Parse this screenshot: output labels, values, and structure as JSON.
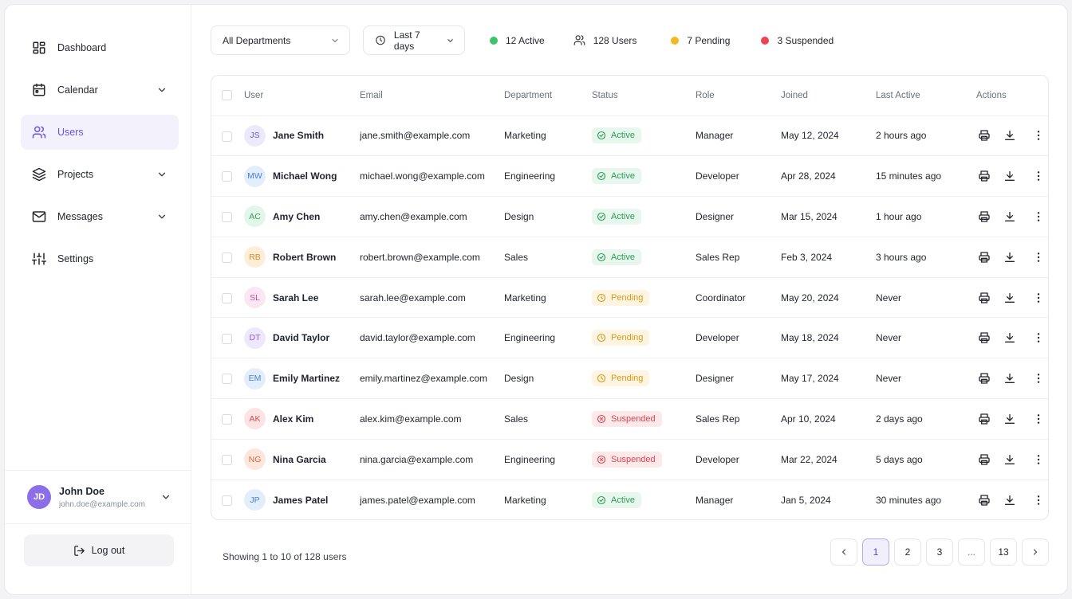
{
  "colors": {
    "accent": "#6d4ee8",
    "active": "#2c9a56",
    "pending": "#d99a12",
    "suspended": "#df4450",
    "dot_active": "#3cc36b",
    "dot_pending": "#f5b81f",
    "dot_suspended": "#ee4452"
  },
  "sidebar": {
    "items": [
      {
        "label": "Dashboard",
        "icon": "dashboard-grid-icon",
        "expandable": false,
        "active": false
      },
      {
        "label": "Calendar",
        "icon": "calendar-icon",
        "expandable": true,
        "active": false
      },
      {
        "label": "Users",
        "icon": "users-icon",
        "expandable": false,
        "active": true
      },
      {
        "label": "Projects",
        "icon": "layers-icon",
        "expandable": true,
        "active": false
      },
      {
        "label": "Messages",
        "icon": "mail-icon",
        "expandable": true,
        "active": false
      },
      {
        "label": "Settings",
        "icon": "sliders-icon",
        "expandable": false,
        "active": false
      }
    ],
    "user": {
      "initials": "JD",
      "name": "John Doe",
      "email": "john.doe@example.com"
    },
    "logout_label": "Log out"
  },
  "toolbar": {
    "department_select": "All Departments",
    "time_select": "Last 7 days",
    "stats": {
      "active": "12 Active",
      "users": "128 Users",
      "pending": "7 Pending",
      "suspended": "3 Suspended"
    }
  },
  "table": {
    "columns": [
      "User",
      "Email",
      "Department",
      "Status",
      "Role",
      "Joined",
      "Last Active",
      "Actions"
    ],
    "rows": [
      {
        "initials": "JS",
        "name": "Jane Smith",
        "email": "jane.smith@example.com",
        "department": "Marketing",
        "status": "Active",
        "role": "Manager",
        "joined": "May 12, 2024",
        "last_active": "2 hours ago",
        "avatar_bg": "#ece9fb",
        "avatar_fg": "#6d5bd0"
      },
      {
        "initials": "MW",
        "name": "Michael Wong",
        "email": "michael.wong@example.com",
        "department": "Engineering",
        "status": "Active",
        "role": "Developer",
        "joined": "Apr 28, 2024",
        "last_active": "15 minutes ago",
        "avatar_bg": "#e3eefc",
        "avatar_fg": "#4a7fd6"
      },
      {
        "initials": "AC",
        "name": "Amy Chen",
        "email": "amy.chen@example.com",
        "department": "Design",
        "status": "Active",
        "role": "Designer",
        "joined": "Mar 15, 2024",
        "last_active": "1 hour ago",
        "avatar_bg": "#e2f6ea",
        "avatar_fg": "#3a9d61"
      },
      {
        "initials": "RB",
        "name": "Robert Brown",
        "email": "robert.brown@example.com",
        "department": "Sales",
        "status": "Active",
        "role": "Sales Rep",
        "joined": "Feb 3, 2024",
        "last_active": "3 hours ago",
        "avatar_bg": "#fdeed9",
        "avatar_fg": "#d98a23"
      },
      {
        "initials": "SL",
        "name": "Sarah Lee",
        "email": "sarah.lee@example.com",
        "department": "Marketing",
        "status": "Pending",
        "role": "Coordinator",
        "joined": "May 20, 2024",
        "last_active": "Never",
        "avatar_bg": "#fbe6f3",
        "avatar_fg": "#cc4f9c"
      },
      {
        "initials": "DT",
        "name": "David Taylor",
        "email": "david.taylor@example.com",
        "department": "Engineering",
        "status": "Pending",
        "role": "Developer",
        "joined": "May 18, 2024",
        "last_active": "Never",
        "avatar_bg": "#efe7fb",
        "avatar_fg": "#8b5bd6"
      },
      {
        "initials": "EM",
        "name": "Emily Martinez",
        "email": "emily.martinez@example.com",
        "department": "Design",
        "status": "Pending",
        "role": "Designer",
        "joined": "May 17, 2024",
        "last_active": "Never",
        "avatar_bg": "#e3eefc",
        "avatar_fg": "#4a7fd6"
      },
      {
        "initials": "AK",
        "name": "Alex Kim",
        "email": "alex.kim@example.com",
        "department": "Sales",
        "status": "Suspended",
        "role": "Sales Rep",
        "joined": "Apr 10, 2024",
        "last_active": "2 days ago",
        "avatar_bg": "#fde4e4",
        "avatar_fg": "#d54b4b"
      },
      {
        "initials": "NG",
        "name": "Nina Garcia",
        "email": "nina.garcia@example.com",
        "department": "Engineering",
        "status": "Suspended",
        "role": "Developer",
        "joined": "Mar 22, 2024",
        "last_active": "5 days ago",
        "avatar_bg": "#fde6dc",
        "avatar_fg": "#dc6b3f"
      },
      {
        "initials": "JP",
        "name": "James Patel",
        "email": "james.patel@example.com",
        "department": "Marketing",
        "status": "Active",
        "role": "Manager",
        "joined": "Jan 5, 2024",
        "last_active": "30 minutes ago",
        "avatar_bg": "#e3eefc",
        "avatar_fg": "#4a7fd6"
      }
    ]
  },
  "footer": {
    "showing": "Showing 1 to 10 of 128 users",
    "pages": [
      "1",
      "2",
      "3",
      "...",
      "13"
    ],
    "current_page": "1"
  }
}
